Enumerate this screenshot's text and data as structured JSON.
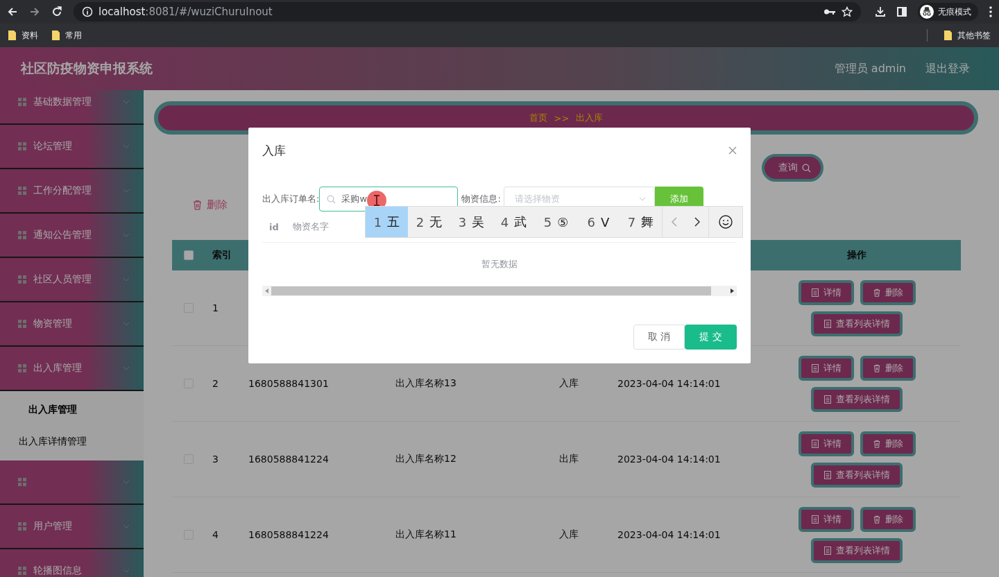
{
  "browser": {
    "url_host": "localhost",
    "url_rest": ":8081/#/wuziChuruInout",
    "incognito_label": "无痕模式",
    "bookmarks": [
      "资料",
      "常用"
    ],
    "other_bookmarks": "其他书签"
  },
  "header": {
    "title": "社区防疫物资申报系统",
    "user": "管理员 admin",
    "logout": "退出登录"
  },
  "sidebar": {
    "items": [
      {
        "kind": "menu",
        "label": "基础数据管理"
      },
      {
        "kind": "menu",
        "label": "论坛管理"
      },
      {
        "kind": "menu",
        "label": "工作分配管理"
      },
      {
        "kind": "menu",
        "label": "通知公告管理"
      },
      {
        "kind": "menu",
        "label": "社区人员管理"
      },
      {
        "kind": "menu",
        "label": "物资管理"
      },
      {
        "kind": "menu",
        "label": "出入库管理",
        "children": [
          {
            "label": "出入库管理",
            "selected": true
          },
          {
            "label": "出入库详情管理",
            "selected": false
          }
        ]
      },
      {
        "kind": "menu"
      },
      {
        "kind": "menu",
        "label": "用户管理"
      },
      {
        "kind": "menu",
        "label": "轮播图信息"
      }
    ]
  },
  "breadcrumb": {
    "items": [
      "首页",
      "出入库"
    ],
    "separator": ">>"
  },
  "search_button": "查询",
  "delete_button": "删除",
  "table": {
    "select_all_checked": false,
    "columns": [
      "索引",
      "操作"
    ],
    "rows": [
      {
        "checked": false,
        "index": "1",
        "cells": [],
        "actions": [
          "详情",
          "删除",
          "查看列表详情"
        ]
      },
      {
        "checked": false,
        "index": "2",
        "cells": [
          "1680588841301",
          "出入库名称13",
          "入库",
          "2023-04-04 14:14:01"
        ],
        "actions": [
          "详情",
          "删除",
          "查看列表详情"
        ]
      },
      {
        "checked": false,
        "index": "3",
        "cells": [
          "1680588841224",
          "出入库名称12",
          "出库",
          "2023-04-04 14:14:01"
        ],
        "actions": [
          "详情",
          "删除",
          "查看列表详情"
        ]
      },
      {
        "checked": false,
        "index": "4",
        "cells": [
          "1680588841224",
          "出入库名称11",
          "入库",
          "2023-04-04 14:14:01"
        ],
        "actions": [
          "详情",
          "删除",
          "查看列表详情"
        ]
      }
    ]
  },
  "modal": {
    "title": "入库",
    "order_label": "出入库订单名:",
    "order_value": "采购w",
    "goods_label": "物资信息:",
    "goods_placeholder": "请选择物资",
    "add_button": "添加",
    "columns": [
      "id",
      "物资名字"
    ],
    "empty_text": "暂无数据",
    "cancel_button": "取 消",
    "submit_button": "提 交"
  },
  "ime": {
    "candidates": [
      {
        "num": "1",
        "text": "五",
        "selected": true
      },
      {
        "num": "2",
        "text": "无",
        "selected": false
      },
      {
        "num": "3",
        "text": "吴",
        "selected": false
      },
      {
        "num": "4",
        "text": "武",
        "selected": false
      },
      {
        "num": "5",
        "text": "⑤",
        "selected": false
      },
      {
        "num": "6",
        "text": "V",
        "selected": false
      },
      {
        "num": "7",
        "text": "舞",
        "selected": false
      }
    ]
  }
}
